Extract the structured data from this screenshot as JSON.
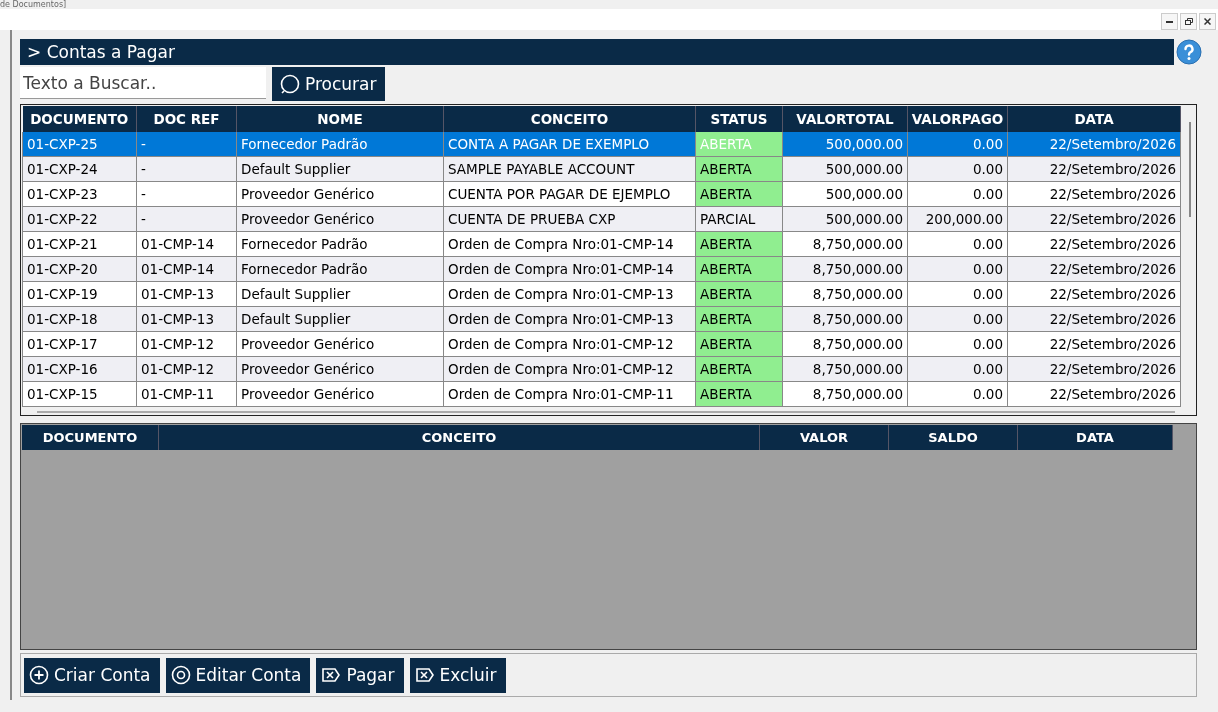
{
  "window": {
    "title": "de Documentos]",
    "controls": [
      {
        "kind": "minimize"
      },
      {
        "kind": "restore"
      },
      {
        "kind": "close"
      }
    ]
  },
  "header": {
    "title": "> Contas a Pagar"
  },
  "search": {
    "placeholder": "Texto a Buscar..",
    "button": "Procurar"
  },
  "table": {
    "columns": [
      "DOCUMENTO",
      "DOC REF",
      "NOME",
      "CONCEITO",
      "STATUS",
      "VALORTOTAL",
      "VALORPAGO",
      "DATA"
    ],
    "rows": [
      {
        "selected": true,
        "status_open": true,
        "cells": [
          "01-CXP-25",
          "-",
          "Fornecedor Padrão",
          "CONTA A PAGAR DE EXEMPLO",
          "ABERTA",
          "500,000.00",
          "0.00",
          "22/Setembro/2026"
        ]
      },
      {
        "selected": false,
        "status_open": true,
        "cells": [
          "01-CXP-24",
          "-",
          "Default Supplier",
          "SAMPLE PAYABLE ACCOUNT",
          "ABERTA",
          "500,000.00",
          "0.00",
          "22/Setembro/2026"
        ]
      },
      {
        "selected": false,
        "status_open": true,
        "cells": [
          "01-CXP-23",
          "-",
          "Proveedor Genérico",
          "CUENTA POR PAGAR DE EJEMPLO",
          "ABERTA",
          "500,000.00",
          "0.00",
          "22/Setembro/2026"
        ]
      },
      {
        "selected": false,
        "status_open": false,
        "cells": [
          "01-CXP-22",
          "-",
          "Proveedor Genérico",
          "CUENTA DE PRUEBA CXP",
          "PARCIAL",
          "500,000.00",
          "200,000.00",
          "22/Setembro/2026"
        ]
      },
      {
        "selected": false,
        "status_open": true,
        "cells": [
          "01-CXP-21",
          "01-CMP-14",
          "Fornecedor Padrão",
          "Orden de Compra Nro:01-CMP-14",
          "ABERTA",
          "8,750,000.00",
          "0.00",
          "22/Setembro/2026"
        ]
      },
      {
        "selected": false,
        "status_open": true,
        "cells": [
          "01-CXP-20",
          "01-CMP-14",
          "Fornecedor Padrão",
          "Orden de Compra Nro:01-CMP-14",
          "ABERTA",
          "8,750,000.00",
          "0.00",
          "22/Setembro/2026"
        ]
      },
      {
        "selected": false,
        "status_open": true,
        "cells": [
          "01-CXP-19",
          "01-CMP-13",
          "Default Supplier",
          "Orden de Compra Nro:01-CMP-13",
          "ABERTA",
          "8,750,000.00",
          "0.00",
          "22/Setembro/2026"
        ]
      },
      {
        "selected": false,
        "status_open": true,
        "cells": [
          "01-CXP-18",
          "01-CMP-13",
          "Default Supplier",
          "Orden de Compra Nro:01-CMP-13",
          "ABERTA",
          "8,750,000.00",
          "0.00",
          "22/Setembro/2026"
        ]
      },
      {
        "selected": false,
        "status_open": true,
        "cells": [
          "01-CXP-17",
          "01-CMP-12",
          "Proveedor Genérico",
          "Orden de Compra Nro:01-CMP-12",
          "ABERTA",
          "8,750,000.00",
          "0.00",
          "22/Setembro/2026"
        ]
      },
      {
        "selected": false,
        "status_open": true,
        "cells": [
          "01-CXP-16",
          "01-CMP-12",
          "Proveedor Genérico",
          "Orden de Compra Nro:01-CMP-12",
          "ABERTA",
          "8,750,000.00",
          "0.00",
          "22/Setembro/2026"
        ]
      },
      {
        "selected": false,
        "status_open": true,
        "cells": [
          "01-CXP-15",
          "01-CMP-11",
          "Proveedor Genérico",
          "Orden de Compra Nro:01-CMP-11",
          "ABERTA",
          "8,750,000.00",
          "0.00",
          "22/Setembro/2026"
        ]
      }
    ]
  },
  "detail_table": {
    "columns": [
      "DOCUMENTO",
      "CONCEITO",
      "VALOR",
      "SALDO",
      "DATA"
    ]
  },
  "actions": [
    {
      "label": "Criar Conta",
      "kind": "add"
    },
    {
      "label": "Editar Conta",
      "kind": "edit"
    },
    {
      "label": "Pagar",
      "kind": "remove"
    },
    {
      "label": "Excluir",
      "kind": "remove"
    }
  ]
}
